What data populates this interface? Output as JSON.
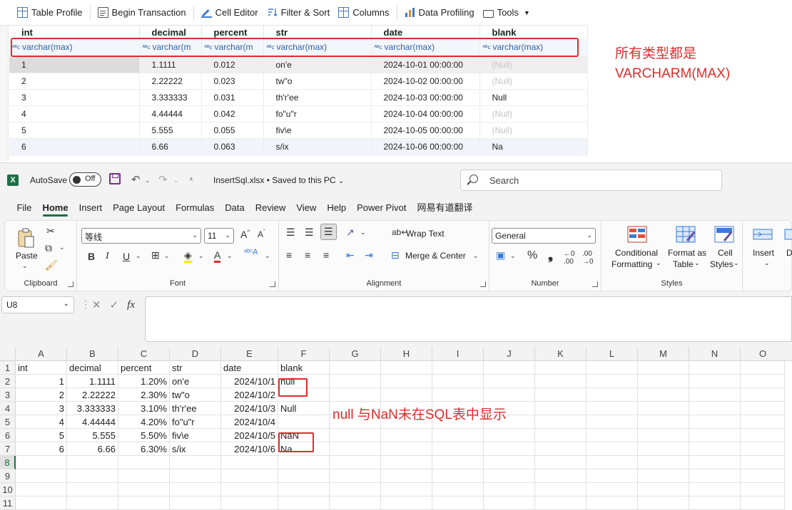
{
  "sql_toolbar": {
    "buttons": [
      "Table Profile",
      "Begin Transaction",
      "Cell Editor",
      "Filter & Sort",
      "Columns",
      "Data Profiling",
      "Tools"
    ]
  },
  "sql_grid": {
    "columns": [
      "int",
      "decimal",
      "percent",
      "str",
      "date",
      "blank"
    ],
    "types": [
      "varchar(max)",
      "varchar(m",
      "varchar(m",
      "varchar(max)",
      "varchar(max)",
      "varchar(max)"
    ],
    "rows": [
      [
        "1",
        "1.1111",
        "0.012",
        "on'e",
        "2024-10-01 00:00:00",
        "(Null)"
      ],
      [
        "2",
        "2.22222",
        "0.023",
        "tw\"o",
        "2024-10-02 00:00:00",
        "(Null)"
      ],
      [
        "3",
        "3.333333",
        "0.031",
        "th'r'ee",
        "2024-10-03 00:00:00",
        "Null"
      ],
      [
        "4",
        "4.44444",
        "0.042",
        "fo\"u\"r",
        "2024-10-04 00:00:00",
        "(Null)"
      ],
      [
        "5",
        "5.555",
        "0.055",
        "fiv\\e",
        "2024-10-05 00:00:00",
        "(Null)"
      ],
      [
        "6",
        "6.66",
        "0.063",
        "s/ix",
        "2024-10-06 00:00:00",
        "Na"
      ]
    ],
    "annotation": [
      "所有类型都是",
      "VARCHARM(MAX)"
    ]
  },
  "excel": {
    "autosave_label": "AutoSave",
    "autosave_state": "Off",
    "file_title": "InsertSql.xlsx • Saved to this PC",
    "search_placeholder": "Search",
    "menu": [
      "File",
      "Home",
      "Insert",
      "Page Layout",
      "Formulas",
      "Data",
      "Review",
      "View",
      "Help",
      "Power Pivot",
      "网易有道翻译"
    ],
    "ribbon": {
      "clipboard": {
        "paste": "Paste",
        "label": "Clipboard"
      },
      "font": {
        "name": "等线",
        "size": "11",
        "label": "Font"
      },
      "alignment": {
        "wrap": "Wrap Text",
        "merge": "Merge & Center",
        "label": "Alignment"
      },
      "number": {
        "format": "General",
        "label": "Number"
      },
      "styles": {
        "conditional": [
          "Conditional",
          "Formatting"
        ],
        "format_table": [
          "Format as",
          "Table"
        ],
        "cell_styles": [
          "Cell",
          "Styles"
        ],
        "label": "Styles"
      },
      "cells": {
        "insert": "Insert",
        "delete": "De"
      }
    },
    "name_box": "U8",
    "col_headers": [
      "A",
      "B",
      "C",
      "D",
      "E",
      "F",
      "G",
      "H",
      "I",
      "J",
      "K",
      "L",
      "M",
      "N",
      "O"
    ],
    "row_numbers": [
      "1",
      "2",
      "3",
      "4",
      "5",
      "6",
      "7",
      "8",
      "9",
      "10",
      "11"
    ],
    "cells": [
      [
        "int",
        "decimal",
        "percent",
        "str",
        "date",
        "blank"
      ],
      [
        "1",
        "1.1111",
        "1.20%",
        "on'e",
        "2024/10/1",
        "null"
      ],
      [
        "2",
        "2.22222",
        "2.30%",
        "tw\"o",
        "2024/10/2",
        ""
      ],
      [
        "3",
        "3.333333",
        "3.10%",
        "th'r'ee",
        "2024/10/3",
        "Null"
      ],
      [
        "4",
        "4.44444",
        "4.20%",
        "fo\"u\"r",
        "2024/10/4",
        ""
      ],
      [
        "5",
        "5.555",
        "5.50%",
        "fiv\\e",
        "2024/10/5",
        "NaN"
      ],
      [
        "6",
        "6.66",
        "6.30%",
        "s/ix",
        "2024/10/6",
        "Na"
      ]
    ],
    "annotation": "null 与NaN未在SQL表中显示"
  }
}
